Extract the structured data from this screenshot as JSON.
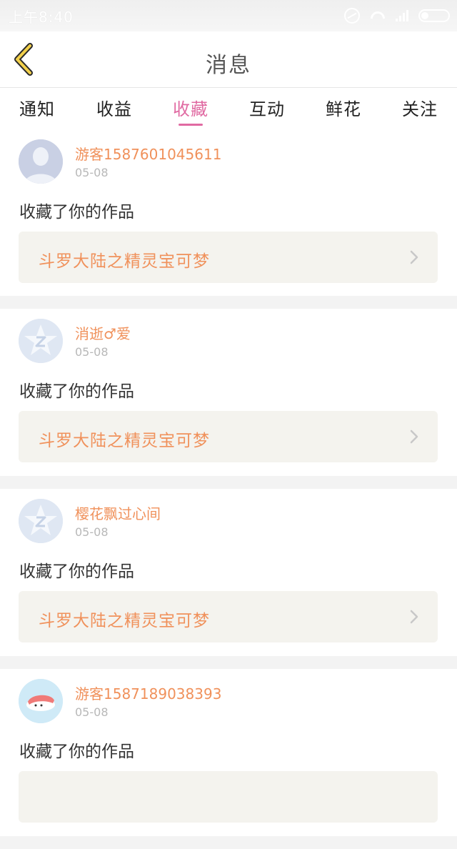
{
  "status_bar": {
    "time": "上午8:40",
    "icons": [
      "do-not-disturb-icon",
      "wifi-icon",
      "signal-icon",
      "battery-icon"
    ]
  },
  "header": {
    "title": "消息",
    "back_icon": "back-chevron-icon"
  },
  "tabs": [
    {
      "label": "通知",
      "active": false
    },
    {
      "label": "收益",
      "active": false
    },
    {
      "label": "收藏",
      "active": true
    },
    {
      "label": "互动",
      "active": false
    },
    {
      "label": "鲜花",
      "active": false
    },
    {
      "label": "关注",
      "active": false
    }
  ],
  "colors": {
    "accent_pink": "#e06aa2",
    "username_orange": "#f0915b",
    "work_bg": "#f4f3ee"
  },
  "items": [
    {
      "username": "游客1587601045611",
      "date": "05-08",
      "action": "收藏了你的作品",
      "work_title": "斗罗大陆之精灵宝可梦",
      "avatar": "default-avatar"
    },
    {
      "username": "消逝♂爱",
      "date": "05-08",
      "action": "收藏了你的作品",
      "work_title": "斗罗大陆之精灵宝可梦",
      "avatar": "qq-avatar"
    },
    {
      "username": "樱花飘过心间",
      "date": "05-08",
      "action": "收藏了你的作品",
      "work_title": "斗罗大陆之精灵宝可梦",
      "avatar": "qq-avatar"
    },
    {
      "username": "游客1587189038393",
      "date": "05-08",
      "action": "收藏了你的作品",
      "work_title": "",
      "avatar": "custom-avatar"
    }
  ]
}
